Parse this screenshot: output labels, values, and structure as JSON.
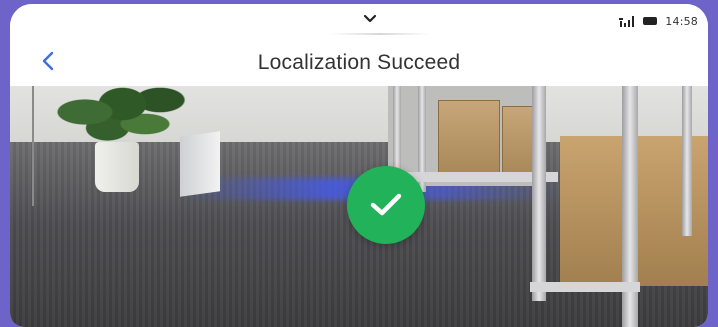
{
  "status_bar": {
    "time": "14:58",
    "icons": [
      "signal-icon",
      "battery-icon"
    ]
  },
  "header": {
    "title": "Localization Succeed",
    "back_icon": "chevron-left-icon",
    "pull_icon": "chevron-down-icon"
  },
  "result": {
    "icon": "checkmark-icon",
    "state": "success"
  },
  "colors": {
    "accent": "#3d6ee0",
    "success": "#21b25a",
    "title_text": "#333333",
    "frame": "#6e63c9"
  }
}
